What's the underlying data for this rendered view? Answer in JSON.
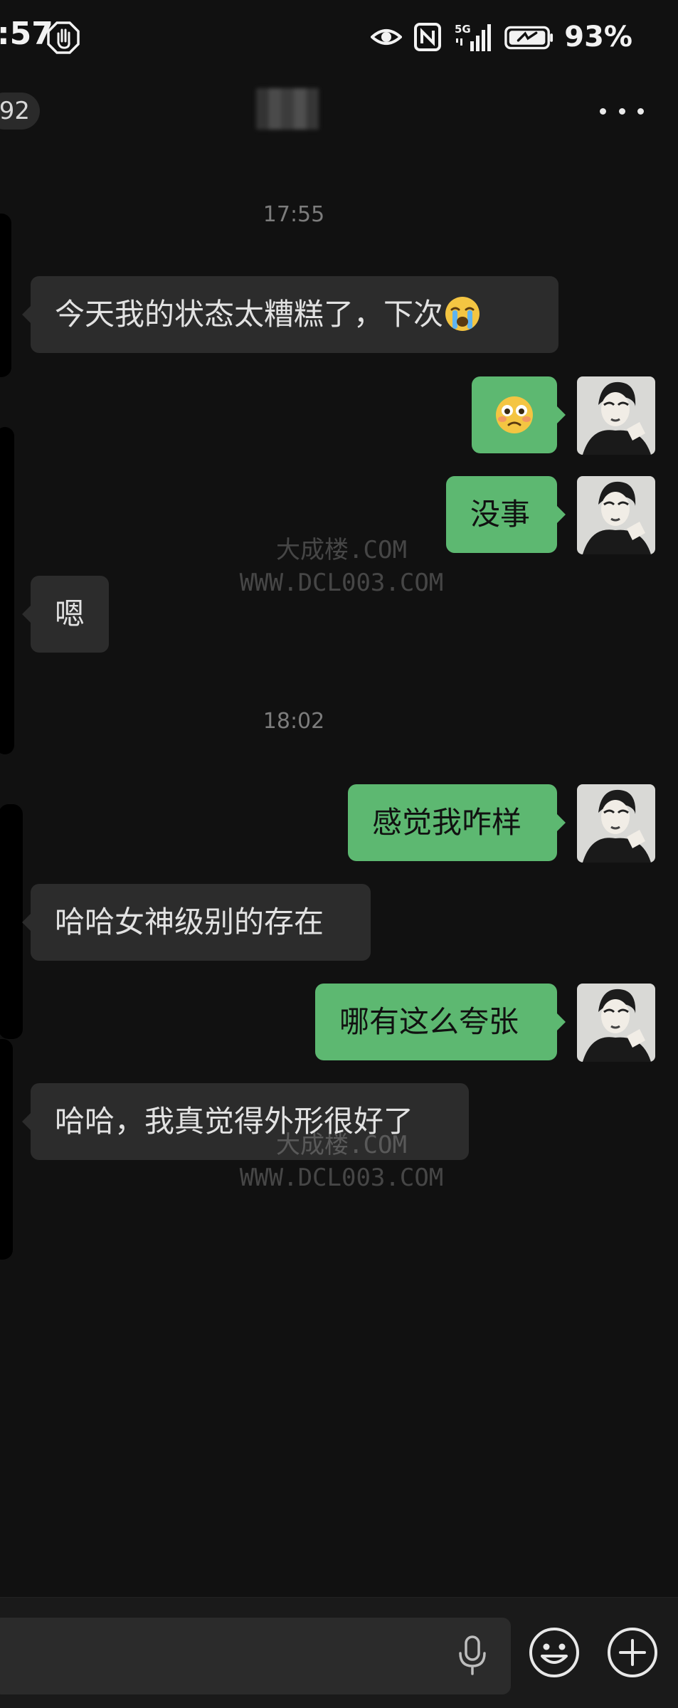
{
  "status_bar": {
    "time": ":57",
    "battery": "93%",
    "signal_label": "5G",
    "icons": [
      "hand-stop-icon",
      "eye-icon",
      "nfc-icon",
      "5g-signal-icon",
      "battery-charging-icon"
    ]
  },
  "nav": {
    "unread_count": "92",
    "contact_name": "",
    "icons": [
      "more-icon"
    ]
  },
  "chat": {
    "timestamps": [
      "17:55",
      "18:02"
    ],
    "messages": [
      {
        "side": "left",
        "text": "今天我的状态太糟糕了，下次",
        "emoji": "crying-face"
      },
      {
        "side": "right",
        "text": "",
        "emoji": "flushed-face"
      },
      {
        "side": "right",
        "text": "没事"
      },
      {
        "side": "left",
        "text": "嗯"
      },
      {
        "side": "right",
        "text": "感觉我咋样"
      },
      {
        "side": "left",
        "text": "哈哈女神级别的存在"
      },
      {
        "side": "right",
        "text": "哪有这么夸张"
      },
      {
        "side": "left",
        "text": "哈哈，我真觉得外形很好了"
      }
    ]
  },
  "watermark": {
    "line1": "大成楼.COM",
    "line2": "WWW.DCL003.COM"
  },
  "input_bar": {
    "placeholder": "",
    "icons": [
      "microphone-icon",
      "emoji-icon",
      "add-icon"
    ]
  },
  "colors": {
    "background": "#111111",
    "sent_bubble": "#5db871",
    "received_bubble": "#2c2c2c"
  }
}
